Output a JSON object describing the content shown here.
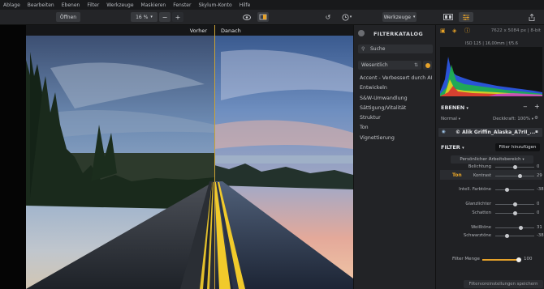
{
  "menu": [
    "Ablage",
    "Bearbeiten",
    "Ebenen",
    "Filter",
    "Werkzeuge",
    "Maskieren",
    "Fenster",
    "Skylum-Konto",
    "Hilfe"
  ],
  "toolbar": {
    "open_label": "Öffnen",
    "zoom": "16 %",
    "zoom_minus": "−",
    "zoom_plus": "+",
    "tools_label": "Werkzeuge"
  },
  "canvas": {
    "before_label": "Vorher",
    "after_label": "Danach"
  },
  "catalog": {
    "title": "FILTERKATALOG",
    "search_placeholder": "Suche",
    "category": "Wesentlich",
    "items": [
      "Accent - Verbessert durch AI",
      "Entwickeln",
      "S&W-Umwandlung",
      "Sättigung/Vitalität",
      "Struktur",
      "Ton",
      "Vignettierung"
    ]
  },
  "right": {
    "dims": "7622 x 5084 px  |  8-bit",
    "exif": "ISO 125  |  16,00mm  |  f/5.6",
    "layers_title": "EBENEN",
    "layers_add": "+",
    "layers_remove": "−",
    "blend_mode": "Normal",
    "opacity": "Deckkraft: 100%",
    "layer_name": "© Alik Griffin_Alaska_A7rII_...",
    "filter_title": "FILTER",
    "add_filter": "Filter hinzufügen",
    "preset": "Persönlicher Arbeitsbereich",
    "section": "Ton",
    "sliders": [
      {
        "label": "Belichtung",
        "value": "0",
        "pos": 0.5
      },
      {
        "label": "Kontrast",
        "value": "29",
        "pos": 0.64
      },
      {
        "label": "Intell. Farbtöne",
        "value": "-38",
        "pos": 0.31
      },
      {
        "label": "Glanzlichter",
        "value": "0",
        "pos": 0.5
      },
      {
        "label": "Schatten",
        "value": "0",
        "pos": 0.5
      },
      {
        "label": "Weißtöne",
        "value": "31",
        "pos": 0.65
      },
      {
        "label": "Schwarztöne",
        "value": "-38",
        "pos": 0.31
      }
    ],
    "filter_amount_label": "Filter Menge",
    "filter_amount": "100",
    "save_button": "Filtervoreinstellungen speichern"
  },
  "colors": {
    "accent": "#e6a22a",
    "panel": "#202124",
    "divider": "#caa235"
  }
}
